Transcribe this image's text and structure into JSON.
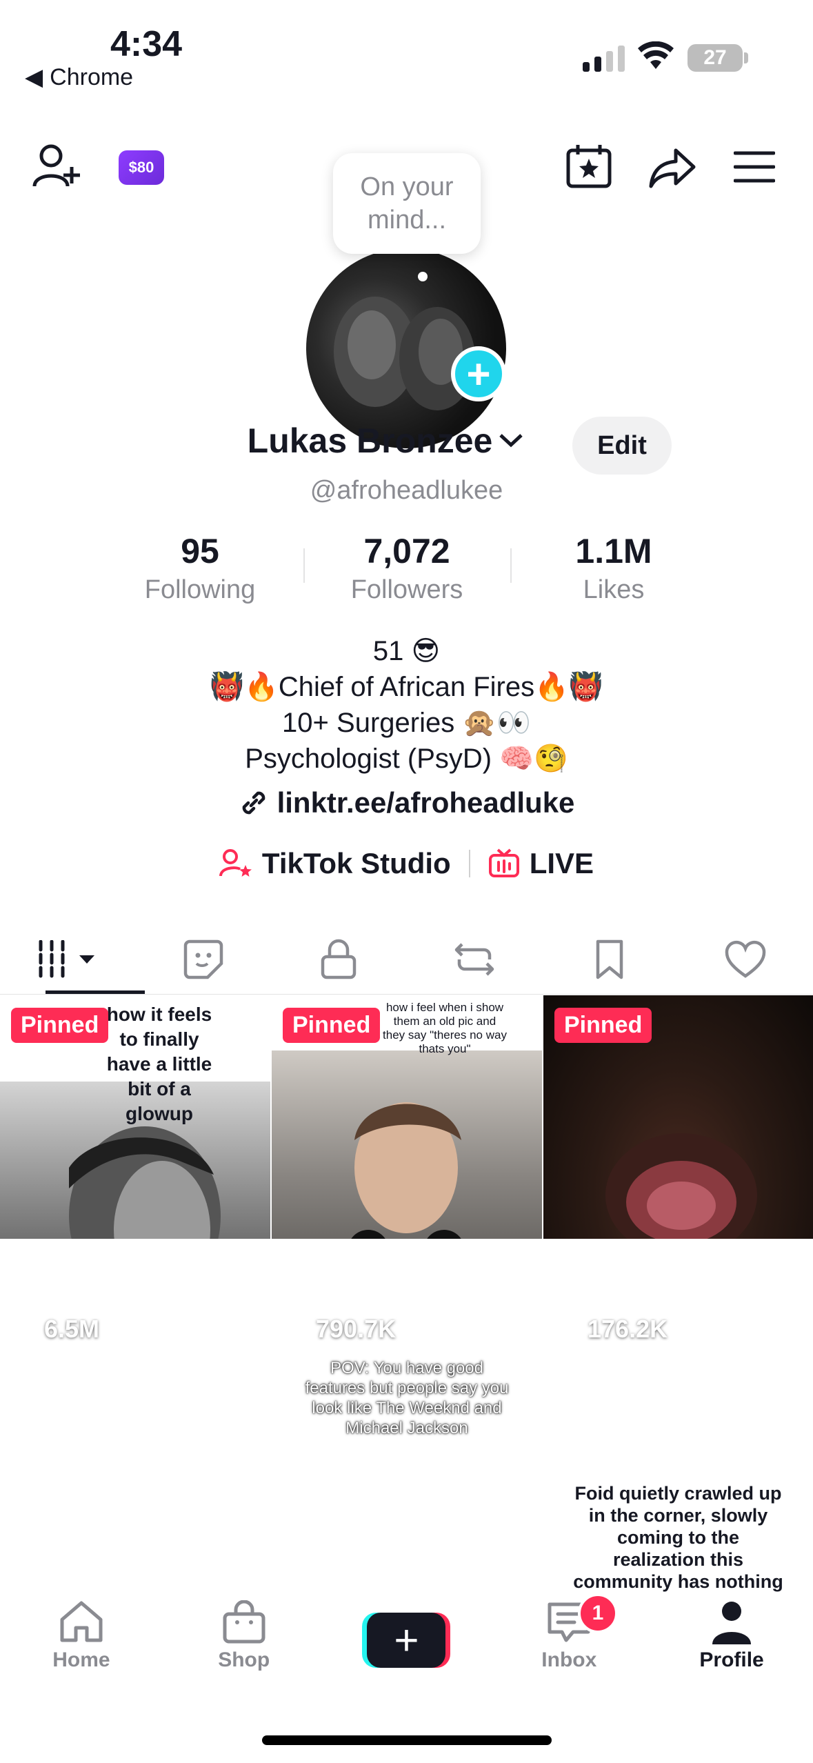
{
  "status": {
    "time": "4:34",
    "back_app": "Chrome",
    "battery": "27"
  },
  "top_bar": {
    "coin_label": "$80"
  },
  "profile": {
    "bubble_text": "On your mind...",
    "name": "Lukas Bronzee",
    "edit_label": "Edit",
    "handle": "@afroheadlukee",
    "stats": [
      {
        "value": "95",
        "label": "Following"
      },
      {
        "value": "7,072",
        "label": "Followers"
      },
      {
        "value": "1.1M",
        "label": "Likes"
      }
    ],
    "bio": [
      "51 😎",
      "👹🔥Chief of African Fires🔥👹",
      "10+ Surgeries 🙊👀",
      "Psychologist (PsyD) 🧠🧐"
    ],
    "link": "linktr.ee/afroheadluke"
  },
  "tools": {
    "studio": "TikTok Studio",
    "live": "LIVE"
  },
  "videos": [
    {
      "pinned": "Pinned",
      "views": "6.5M",
      "caption": "how it feels to finally have a little bit of a glowup"
    },
    {
      "pinned": "Pinned",
      "views": "790.7K",
      "caption": "how i feel when i show them an old pic and they say \"theres no way thats you\""
    },
    {
      "pinned": "Pinned",
      "views": "176.2K",
      "caption": ""
    },
    {
      "pinned": "",
      "views": "",
      "caption": ""
    },
    {
      "pinned": "",
      "views": "",
      "caption": "POV: You have good features but people say you look like The Weeknd and Michael Jackson"
    },
    {
      "pinned": "",
      "views": "",
      "caption": "Foid quietly crawled up in the corner, slowly coming to the realization this community has nothing valuable to offer her..."
    }
  ],
  "nav": {
    "home": "Home",
    "shop": "Shop",
    "inbox": "Inbox",
    "inbox_badge": "1",
    "profile": "Profile"
  },
  "colors": {
    "accent": "#fe2c55",
    "cyan": "#25f4ee",
    "plus_badge": "#20d5ec"
  }
}
